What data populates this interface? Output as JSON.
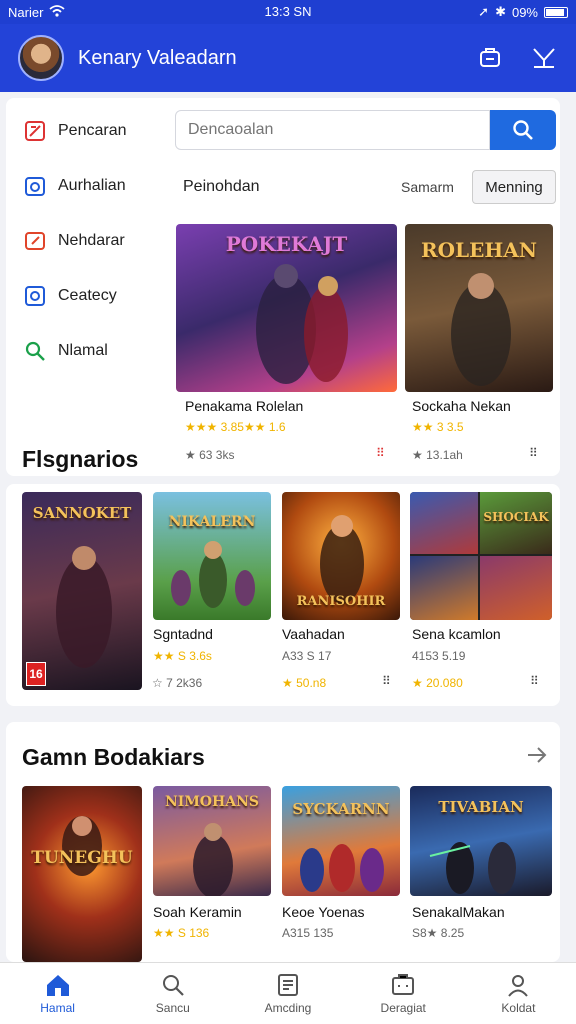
{
  "status": {
    "carrier": "Narier",
    "time": "13:3 SN",
    "battery": "09%"
  },
  "appbar": {
    "title": "Kenary Valeadarn"
  },
  "sidebar": {
    "items": [
      {
        "label": "Pencaran",
        "icon": "search-alert-icon",
        "color": "#d33"
      },
      {
        "label": "Aurhalian",
        "icon": "calendar-icon",
        "color": "#1f5ad8"
      },
      {
        "label": "Nehdarar",
        "icon": "edit-icon",
        "color": "#e0442a"
      },
      {
        "label": "Ceatecy",
        "icon": "target-icon",
        "color": "#1f5ad8"
      },
      {
        "label": "Nlamal",
        "icon": "search-icon",
        "color": "#1aa04a"
      }
    ]
  },
  "search": {
    "placeholder": "Dencaoalan"
  },
  "featured": {
    "title": "Peinohdan",
    "sort_label": "Samarm",
    "filter_label": "Menning",
    "cards": [
      {
        "art_text": "POKEKAJT",
        "title": "Penakama Rolelan",
        "rating": "★★★ 3.85★★ 1.6",
        "meta": "★ 63 3ks"
      },
      {
        "art_text": "ROLEHAN",
        "title": "Sockaha Nekan",
        "rating": "★★ 3 3.5",
        "meta": "★ 13.1ah"
      }
    ]
  },
  "section1": {
    "title": "Flsgnarios",
    "cards": [
      {
        "art_text": "SANNOKET",
        "title": "",
        "meta": "☆ 7 2k36",
        "age": "16"
      },
      {
        "art_text": "NIKALERN",
        "title": "Sgntadnd",
        "rating": "★★ S 3.6s",
        "meta": ""
      },
      {
        "art_text": "RANISOHIR",
        "title": "Vaahadan",
        "rating": "A33 S 17",
        "meta": "★ 50.n8"
      },
      {
        "art_text": "SHOCIAK",
        "title": "Sena kcamlon",
        "rating": "4153 5.19",
        "meta": "★ 20.080"
      }
    ]
  },
  "section2": {
    "title": "Gamn Bodakiars",
    "cards": [
      {
        "art_text": "TUNEGHU",
        "title": "",
        "rating": "",
        "meta": ""
      },
      {
        "art_text": "NIMOHANS",
        "title": "Soah Keramin",
        "rating": "★★ S 136",
        "meta": ""
      },
      {
        "art_text": "SYCKARNN",
        "title": "Keoe Yoenas",
        "rating": "A315 135",
        "meta": ""
      },
      {
        "art_text": "TIVABIAN",
        "title": "SenakalMakan",
        "rating": "S8★ 8.25",
        "meta": ""
      }
    ]
  },
  "bottomnav": [
    {
      "label": "Hamal",
      "icon": "home-icon"
    },
    {
      "label": "Sancu",
      "icon": "search-icon"
    },
    {
      "label": "Amcding",
      "icon": "list-icon"
    },
    {
      "label": "Deragiat",
      "icon": "box-icon"
    },
    {
      "label": "Koldat",
      "icon": "user-icon"
    }
  ]
}
